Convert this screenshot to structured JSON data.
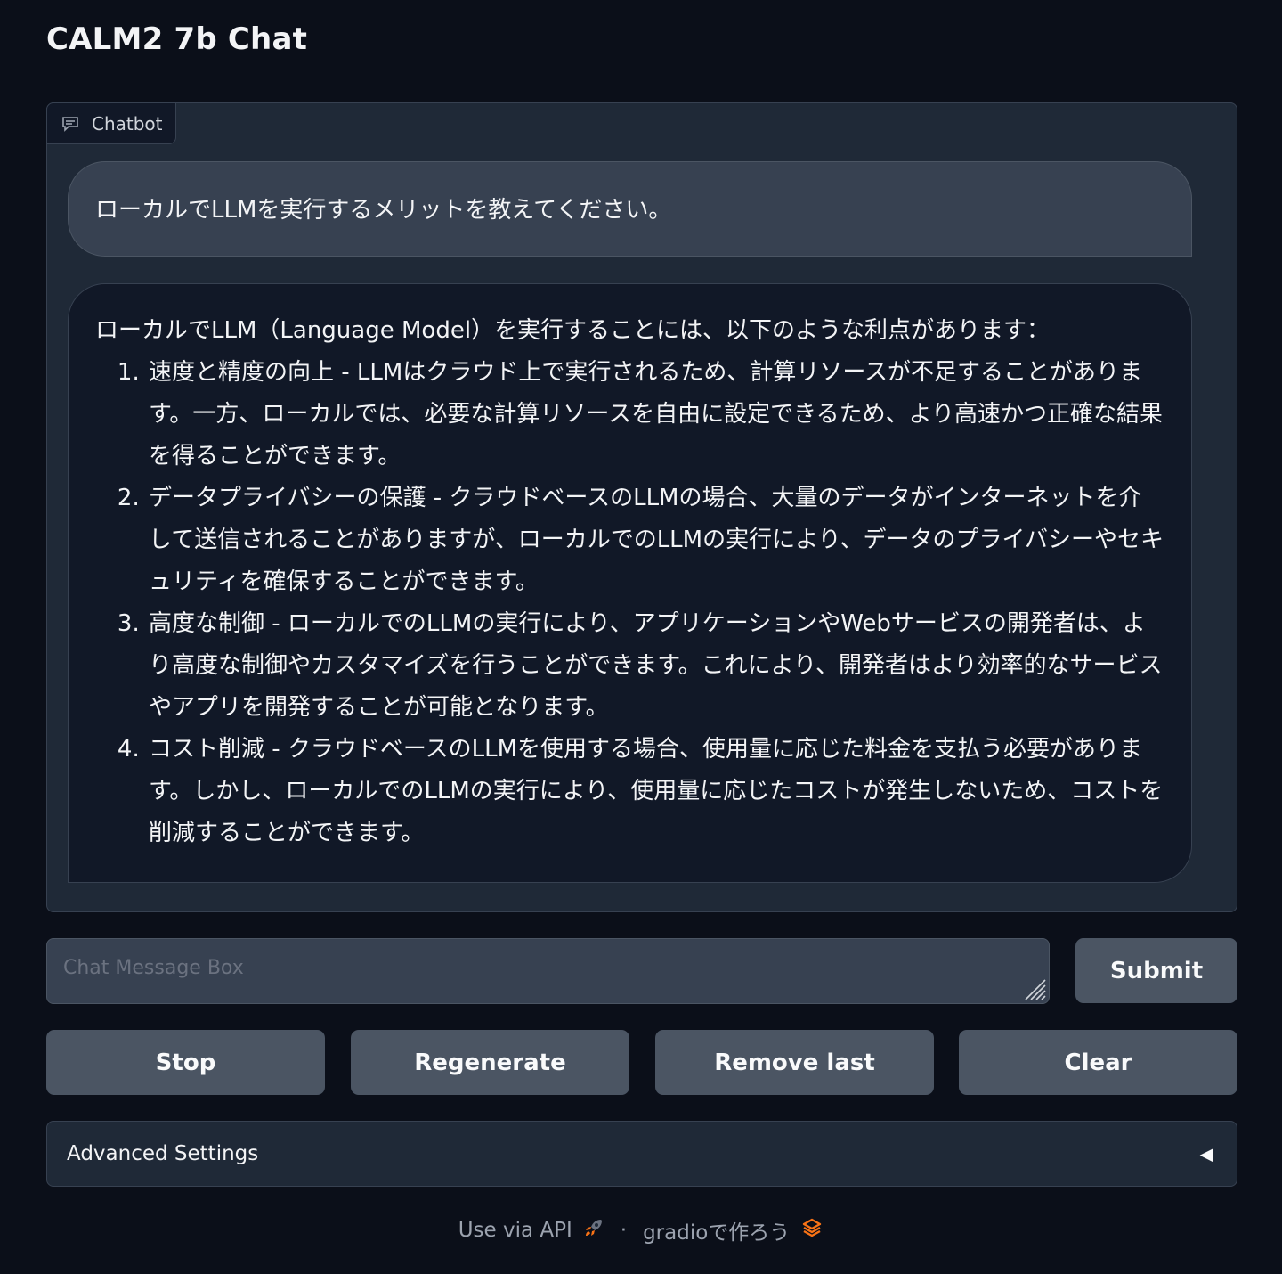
{
  "app": {
    "title": "CALM2 7b Chat"
  },
  "chatbot": {
    "label": "Chatbot",
    "user_message": "ローカルでLLMを実行するメリットを教えてください。",
    "bot_message": {
      "intro": "ローカルでLLM（Language Model）を実行することには、以下のような利点があります：",
      "items": [
        "速度と精度の向上 - LLMはクラウド上で実行されるため、計算リソースが不足することがあります。一方、ローカルでは、必要な計算リソースを自由に設定できるため、より高速かつ正確な結果を得ることができます。",
        "データプライバシーの保護 - クラウドベースのLLMの場合、大量のデータがインターネットを介して送信されることがありますが、ローカルでのLLMの実行により、データのプライバシーやセキュリティを確保することができます。",
        "高度な制御 - ローカルでのLLMの実行により、アプリケーションやWebサービスの開発者は、より高度な制御やカスタマイズを行うことができます。これにより、開発者はより効率的なサービスやアプリを開発することが可能となります。",
        "コスト削減 - クラウドベースのLLMを使用する場合、使用量に応じた料金を支払う必要があります。しかし、ローカルでのLLMの実行により、使用量に応じたコストが発生しないため、コストを削減することができます。"
      ]
    }
  },
  "input": {
    "placeholder": "Chat Message Box",
    "value": ""
  },
  "buttons": {
    "submit": "Submit",
    "stop": "Stop",
    "regenerate": "Regenerate",
    "remove_last": "Remove last",
    "clear": "Clear"
  },
  "advanced": {
    "label": "Advanced Settings",
    "icon": "triangle-left-icon"
  },
  "footer": {
    "api_text": "Use via API",
    "api_icon": "rocket-icon",
    "separator": "·",
    "gradio_text": "gradioで作ろう",
    "gradio_icon": "gradio-logo-icon"
  },
  "colors": {
    "background": "#0b0f19",
    "panel": "#1f2937",
    "button": "#4b5563",
    "accent": "#f97316"
  }
}
